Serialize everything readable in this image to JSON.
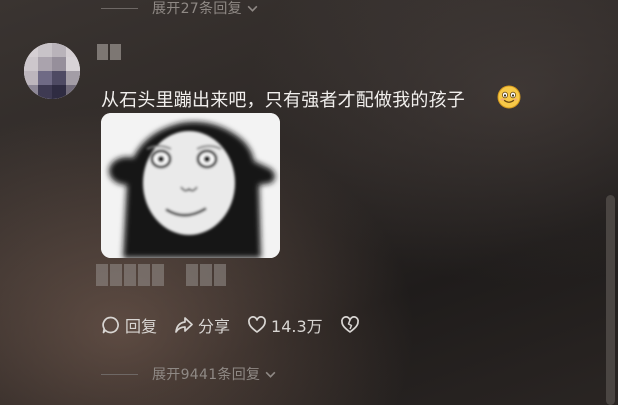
{
  "replies_expand_top": {
    "label": "展开27条回复"
  },
  "comment": {
    "text": "从石头里蹦出来吧，只有强者才配做我的孩子",
    "emoji_icon": "smiling-face-emoji"
  },
  "actions": {
    "reply_label": "回复",
    "share_label": "分享",
    "like_count": "14.3万"
  },
  "replies_expand_bottom": {
    "label": "展开9441条回复"
  }
}
